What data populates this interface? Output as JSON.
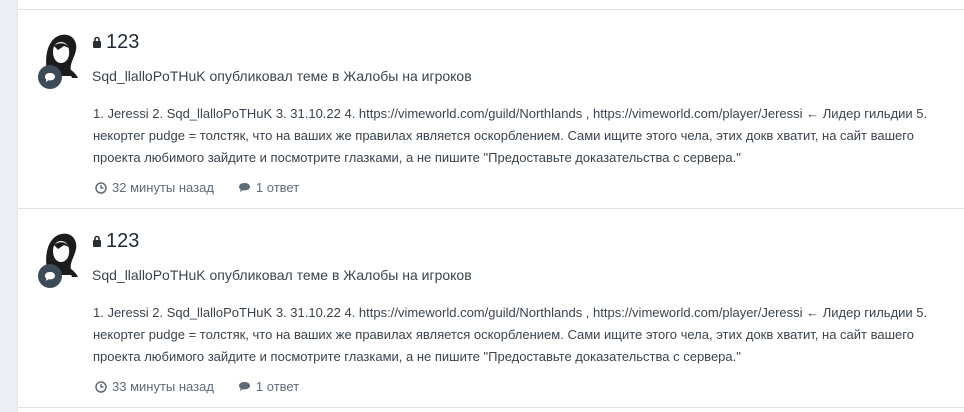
{
  "entries": [
    {
      "title": "123",
      "meta": "Sqd_llalloPoTHuK опубликовал теме в Жалобы на игроков",
      "body": "1. Jeressi 2. Sqd_llalloPoTHuK 3. 31.10.22 4. https://vimeworld.com/guild/Northlands , https://vimeworld.com/player/Jeressi ← Лидер гильдии 5. некортег pudge = толстяк, что на ваших же правилах является оскорблением. Сами ищите этого чела, этих докв хватит, на сайт вашего проекта любимого зайдите и посмотрите глазками, а не пишите \"Предоставьте доказательства с сервера.\"",
      "time": "32 минуты назад",
      "replies": "1 ответ"
    },
    {
      "title": "123",
      "meta": "Sqd_llalloPoTHuK опубликовал теме в Жалобы на игроков",
      "body": "1. Jeressi 2. Sqd_llalloPoTHuK 3. 31.10.22 4. https://vimeworld.com/guild/Northlands , https://vimeworld.com/player/Jeressi ← Лидер гильдии 5. некортег pudge = толстяк, что на ваших же правилах является оскорблением. Сами ищите этого чела, этих докв хватит, на сайт вашего проекта любимого зайдите и посмотрите глазками, а не пишите \"Предоставьте доказательства с сервера.\"",
      "time": "33 минуты назад",
      "replies": "1 ответ"
    }
  ]
}
